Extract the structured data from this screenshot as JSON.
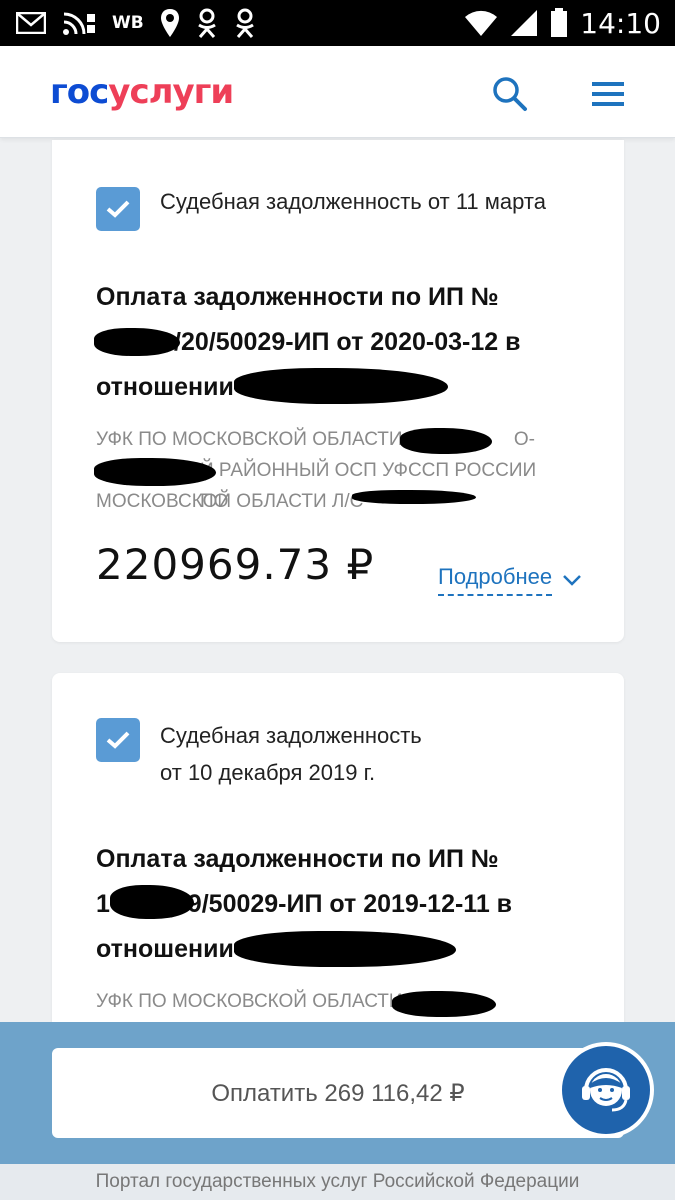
{
  "statusbar": {
    "wb_text": "WB",
    "time": "14:10"
  },
  "header": {
    "logo_part1": "гос",
    "logo_part2": "услуги"
  },
  "cards": [
    {
      "checked": true,
      "debt_label": "Судебная задолженность от 11 марта",
      "debt_label_line2": "",
      "title_line1": "Оплата задолженности по ИП №",
      "title_line2": "/20/50029-ИП от 2020-03-12 в",
      "title_line3": "отношении",
      "recipient_line1": "УФК ПО МОСКОВСКОЙ ОБЛАСТИ (С",
      "recipient_line1_tail": "О-",
      "recipient_line2": "Й РАЙОННЫЙ ОСП УФССП РОССИИ ПО",
      "recipient_line3": "МОСКОВСКОЙ ОБЛАСТИ Л/С",
      "amount": "220969.73 ₽",
      "details_label": "Подробнее"
    },
    {
      "checked": true,
      "debt_label": "Судебная задолженность",
      "debt_label_line2": "от 10 декабря 2019 г.",
      "title_line1": "Оплата задолженности по ИП №",
      "title_line2": "19/50029-ИП от 2019-12-11 в",
      "title_prefix2": "1",
      "title_line3": "отношении",
      "recipient_line1": "УФК ПО МОСКОВСКОЙ ОБЛАСТИ"
    }
  ],
  "pay_button_label": "Оплатить 269 116,42 ₽",
  "footer_text": "Портал государственных услуг Российской Федерации",
  "colors": {
    "brand_blue": "#0d4cd3",
    "brand_red": "#ee3f58",
    "checkbox": "#5a9bd5",
    "link": "#1e73be",
    "paybar": "#6ea3ca",
    "support": "#1f63ac"
  },
  "icons": [
    "mail-icon",
    "rss-icon",
    "location-icon",
    "odnoklassniki-icon",
    "wifi-icon",
    "signal-icon",
    "battery-icon",
    "search-icon",
    "menu-icon",
    "checkmark-icon",
    "chevron-down-icon",
    "support-operator-icon"
  ]
}
